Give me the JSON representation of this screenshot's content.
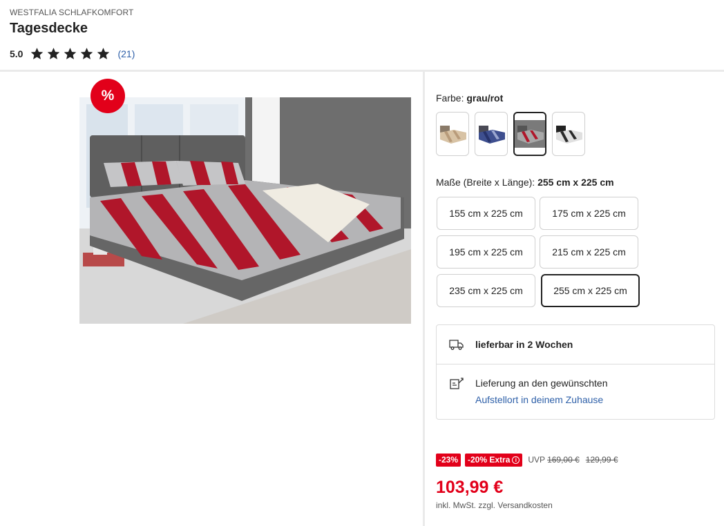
{
  "product": {
    "brand": "WESTFALIA SCHLAFKOMFORT",
    "title": "Tagesdecke",
    "rating_value": "5.0",
    "rating_stars": 5,
    "rating_count": "(21)"
  },
  "gallery": {
    "sale_badge": "%"
  },
  "color": {
    "label": "Farbe: ",
    "selected": "grau/rot",
    "swatches": [
      {
        "name": "beige",
        "accent": "#d8c3a5",
        "stripe": "#b89b7a"
      },
      {
        "name": "blau",
        "accent": "#3e4f8f",
        "stripe": "#27336b"
      },
      {
        "name": "grau/rot",
        "accent": "#a8a8a8",
        "stripe": "#b0162a"
      },
      {
        "name": "schwarz/weiss",
        "accent": "#e0e0e0",
        "stripe": "#2a2a2a"
      }
    ]
  },
  "size": {
    "label": "Maße (Breite x Länge): ",
    "selected": "255 cm x 225 cm",
    "options": [
      "155 cm x 225 cm",
      "175 cm x 225 cm",
      "195 cm x 225 cm",
      "215 cm x 225 cm",
      "235 cm x 225 cm",
      "255 cm x 225 cm"
    ]
  },
  "delivery": {
    "availability": "lieferbar in 2 Wochen",
    "setup_line1": "Lieferung an den gewünschten",
    "setup_link": "Aufstellort in deinem Zuhause"
  },
  "pricing": {
    "discount_tag": "-23%",
    "extra_tag": "-20% Extra",
    "uvp_label": "UVP",
    "uvp_price": "169,00 €",
    "old_price": "129,99 €",
    "price": "103,99 €",
    "tax_note": "inkl. MwSt. zzgl.",
    "shipping_link": "Versandkosten"
  },
  "colors": {
    "sale_red": "#e2001a",
    "link_blue": "#2d5fa8"
  }
}
